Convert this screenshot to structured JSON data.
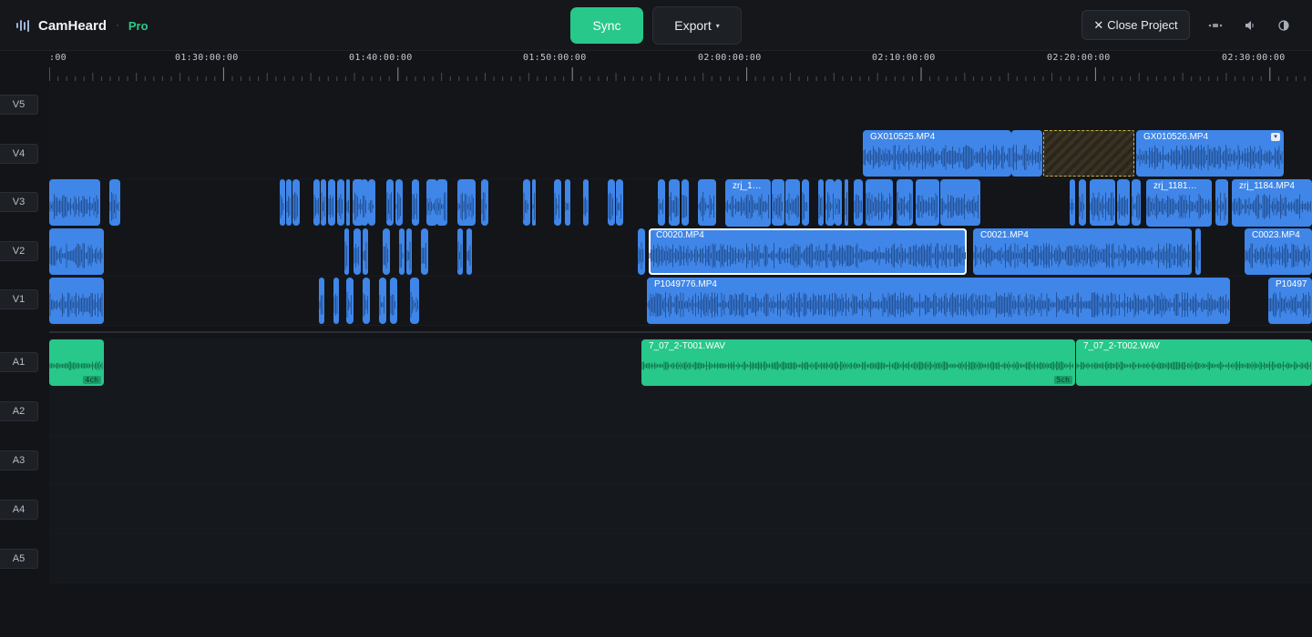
{
  "app": {
    "name": "CamHeard",
    "separator": "·",
    "tier": "Pro"
  },
  "toolbar": {
    "sync_label": "Sync",
    "export_label": "Export",
    "export_caret": "▾",
    "close_label": "Close Project",
    "close_glyph": "✕"
  },
  "header_icons": [
    {
      "name": "camera-link-icon",
      "glyph": "⋯"
    },
    {
      "name": "volume-icon",
      "glyph": "🔈"
    },
    {
      "name": "theme-toggle-icon",
      "glyph": "◐"
    }
  ],
  "ruler": {
    "labels": [
      ":00",
      "01:30:00:00",
      "01:40:00:00",
      "01:50:00:00",
      "02:00:00:00",
      "02:10:00:00",
      "02:20:00:00",
      "02:30:00:00"
    ]
  },
  "tracks": {
    "video": [
      "V5",
      "V4",
      "V3",
      "V2",
      "V1"
    ],
    "audio": [
      "A1",
      "A2",
      "A3",
      "A4",
      "A5"
    ]
  },
  "clips": {
    "v4_1": "GX010525.MP4",
    "v4_2": "GX010526.MP4",
    "v3_1": "zrj_1…",
    "v3_2": "zrj_1181…",
    "v3_3": "zrj_1184.MP4",
    "v2_1": "C0020.MP4",
    "v2_2": "C0021.MP4",
    "v2_3": "C0023.MP4",
    "v1_1": "P1049776.MP4",
    "v1_2": "P10497",
    "a1_1": "7_07_2-T001.WAV",
    "a1_2": "7_07_2-T002.WAV",
    "a1_badge_1": "4ch",
    "a1_badge_2": "5ch"
  },
  "colors": {
    "video_clip": "#3f86e8",
    "audio_clip": "#27c88a",
    "accent": "#27c88a",
    "background": "#121418"
  }
}
